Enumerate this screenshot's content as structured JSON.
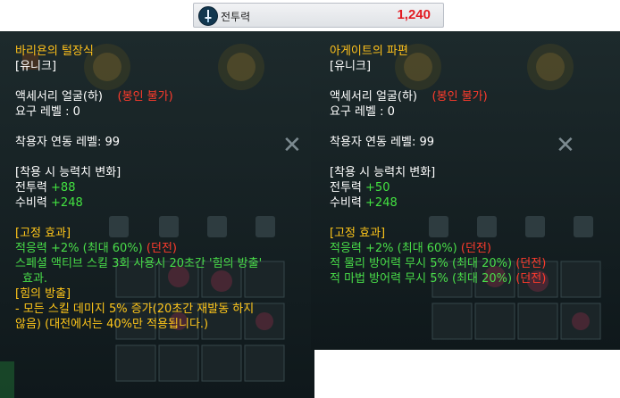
{
  "combat_power": {
    "label": "전투력",
    "value": "1,240",
    "icon": "shield-sword-icon"
  },
  "left": {
    "name": "바리욘의 털장식",
    "grade": "[유니크]",
    "type": "액세서리 얼굴(하)",
    "seal": "(봉인 불가)",
    "req_level": "요구 레벨 : 0",
    "wearer_level": "착용자 연동 레벨: 99",
    "stat_header": "[착용 시 능력치 변화]",
    "stat1_label": "전투력",
    "stat1_value": "+88",
    "stat2_label": "수비력",
    "stat2_value": "+248",
    "fixed_header": "[고정 효과]",
    "fixed1": "적응력 +2% (최대 60%)",
    "fixed1_tag": "(던전)",
    "fixed2": "스페셜 액티브 스킬 3회 사용시 20초간 '힘의 방출'",
    "fixed2b": "효과.",
    "effect_name": "[힘의 방출]",
    "effect_desc1": "- 모든 스킬 데미지 5% 증가(20초간 재발동 하지",
    "effect_desc2": "않음) (대전에서는 40%만 적용됩니다.)"
  },
  "right": {
    "name": "아게이트의 파편",
    "grade": "[유니크]",
    "type": "액세서리 얼굴(하)",
    "seal": "(봉인 불가)",
    "req_level": "요구 레벨 : 0",
    "wearer_level": "착용자 연동 레벨: 99",
    "stat_header": "[착용 시 능력치 변화]",
    "stat1_label": "전투력",
    "stat1_value": "+50",
    "stat2_label": "수비력",
    "stat2_value": "+248",
    "fixed_header": "[고정 효과]",
    "fixed1": "적응력 +2% (최대 60%)",
    "fixed1_tag": "(던전)",
    "fixed2": "적 물리 방어력 무시 5% (최대 20%)",
    "fixed2_tag": "(던전)",
    "fixed3": "적 마법 방어력 무시 5% (최대 20%)",
    "fixed3_tag": "(던전)"
  },
  "colors": {
    "title": "#ffc11a",
    "green": "#43e341",
    "red": "#ff3b2c",
    "cp_value": "#e21b22"
  }
}
